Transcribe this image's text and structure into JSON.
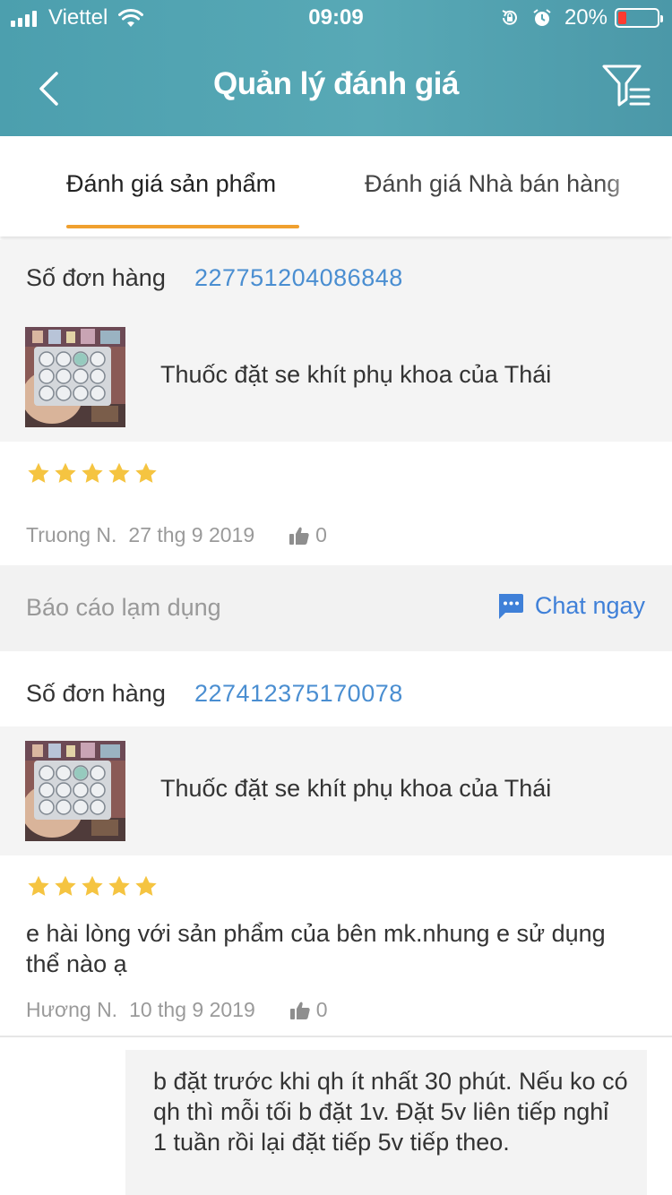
{
  "status_bar": {
    "carrier": "Viettel",
    "time": "09:09",
    "battery": "20%"
  },
  "header": {
    "title": "Quản lý đánh giá"
  },
  "tabs": [
    {
      "label": "Đánh giá sản phẩm",
      "active": true
    },
    {
      "label": "Đánh giá Nhà bán hàng",
      "active": false
    }
  ],
  "colors": {
    "header": "#55a5b3",
    "accent_tab": "#f0a02f",
    "link_blue": "#4a8ed1",
    "star": "#f5c441"
  },
  "reviews": [
    {
      "order_label": "Số đơn hàng",
      "order_number": "227751204086848",
      "product_name": "Thuốc đặt se khít phụ khoa của Thái",
      "rating": 5,
      "text": "",
      "author": "Truong N.",
      "date": "27 thg 9 2019",
      "likes": "0",
      "report_label": "Báo cáo lạm dụng",
      "chat_label": "Chat ngay"
    },
    {
      "order_label": "Số đơn hàng",
      "order_number": "227412375170078",
      "product_name": "Thuốc đặt se khít phụ khoa của Thái",
      "rating": 5,
      "text": "e hài lòng với sản phẩm của bên mk.nhung e sử dụng thể nào ạ",
      "author": "Hương N.",
      "date": "10 thg 9 2019",
      "likes": "0",
      "reply": "b đặt trước khi qh ít nhất 30 phút. Nếu ko có qh thì mỗi tối b đặt 1v. Đặt 5v liên tiếp nghỉ 1 tuần rồi lại đặt tiếp 5v tiếp theo."
    }
  ]
}
